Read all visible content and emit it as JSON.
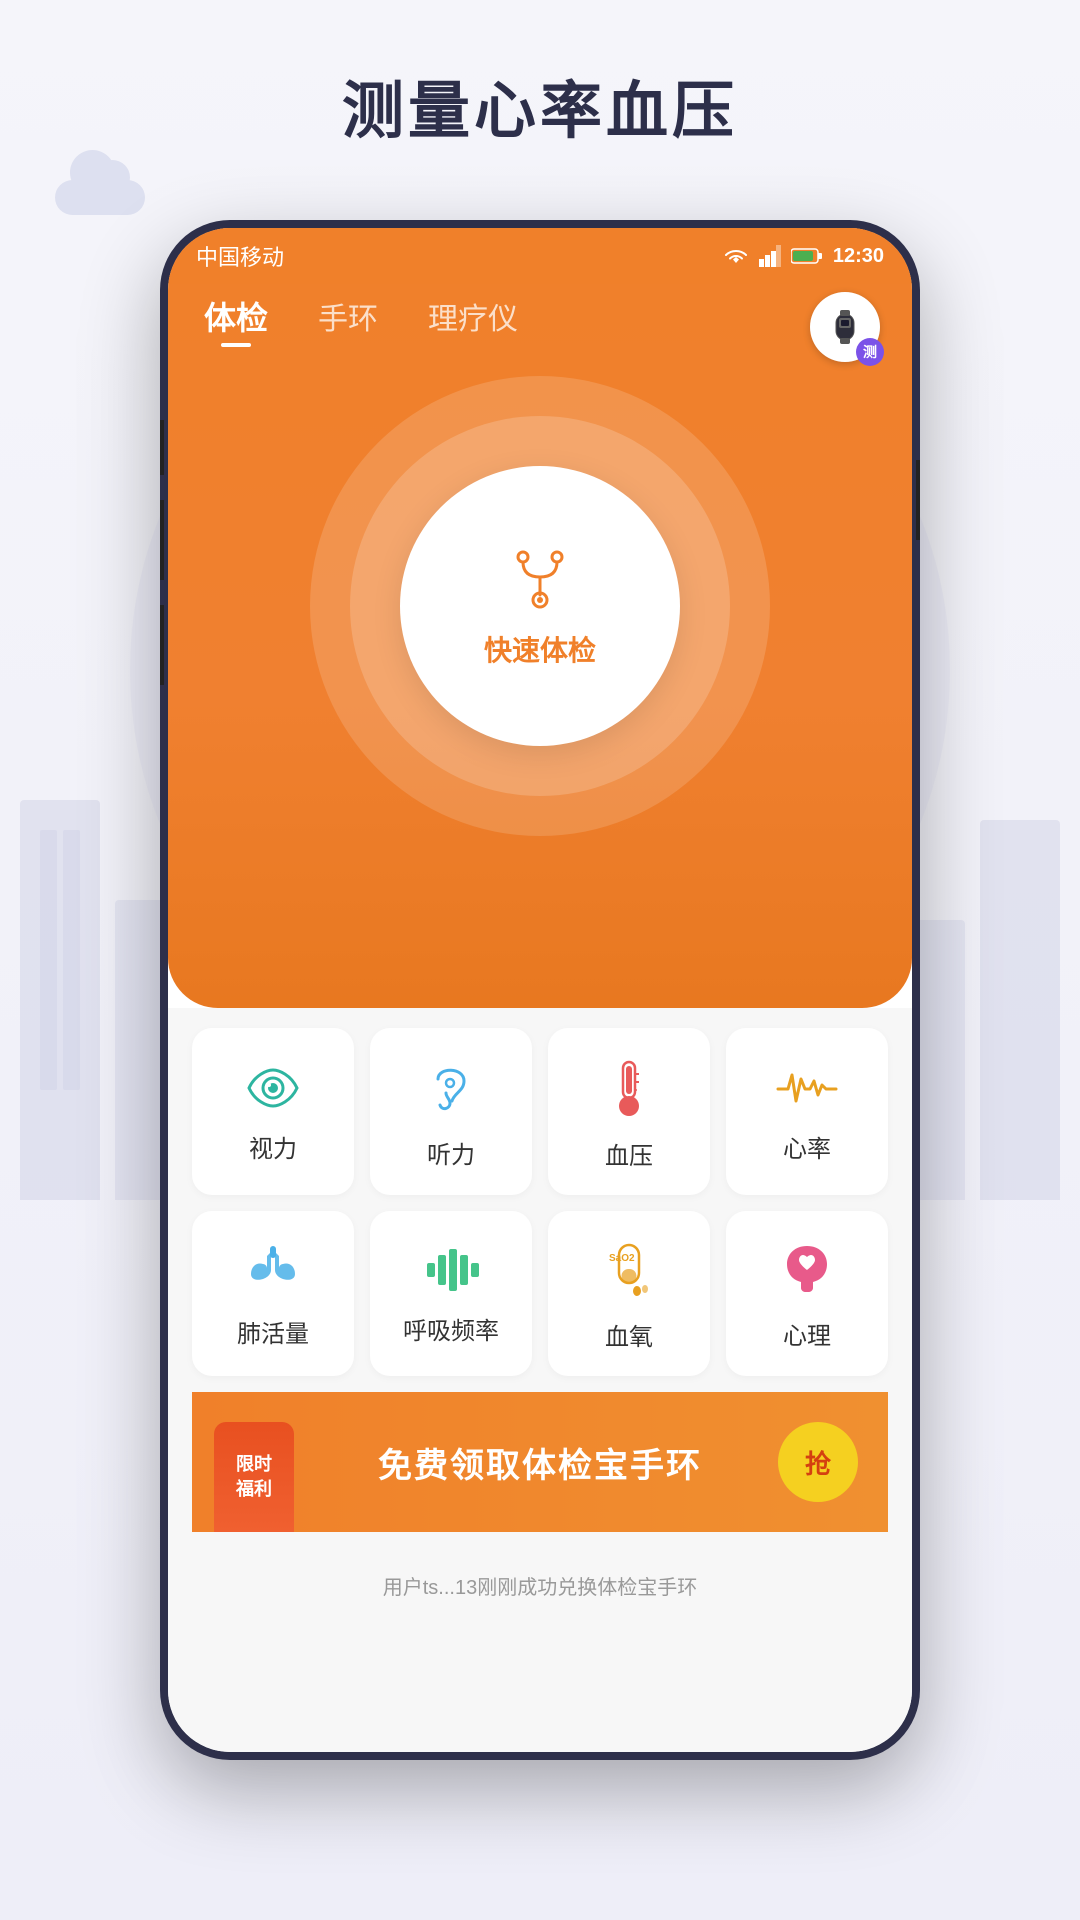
{
  "page": {
    "title": "测量心率血压",
    "background_color": "#f0f1f8"
  },
  "status_bar": {
    "carrier": "中国移动",
    "time": "12:30",
    "signal_icon": "▼",
    "data_icon": "▲",
    "battery_icon": "🔋"
  },
  "tabs": [
    {
      "label": "体检",
      "active": true
    },
    {
      "label": "手环",
      "active": false
    },
    {
      "label": "理疗仪",
      "active": false
    }
  ],
  "wristband_button": {
    "badge": "测"
  },
  "center_button": {
    "label": "快速体检"
  },
  "health_items_row1": [
    {
      "label": "视力",
      "icon": "eye"
    },
    {
      "label": "听力",
      "icon": "ear"
    },
    {
      "label": "血压",
      "icon": "thermometer"
    },
    {
      "label": "心率",
      "icon": "heartrate"
    }
  ],
  "health_items_row2": [
    {
      "label": "肺活量",
      "icon": "lung"
    },
    {
      "label": "呼吸频率",
      "icon": "breath"
    },
    {
      "label": "血氧",
      "icon": "oxygen"
    },
    {
      "label": "心理",
      "icon": "mental"
    }
  ],
  "notification": {
    "text": "用户ts...13刚刚成功兑换体检宝手环"
  },
  "banner": {
    "badge_line1": "限时",
    "badge_line2": "福利",
    "text": "免费领取体检宝手环",
    "grab_label": "抢"
  }
}
